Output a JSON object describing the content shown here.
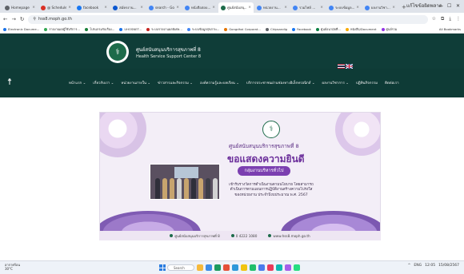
{
  "browser": {
    "tabs": [
      {
        "label": "Homepage",
        "color": "#5f6368",
        "active": false
      },
      {
        "label": "@ Schedule",
        "color": "#d93025",
        "active": false
      },
      {
        "label": "facebook",
        "color": "#1877f2",
        "active": false
      },
      {
        "label": "สมัครงาน...",
        "color": "#0b57d0",
        "active": false
      },
      {
        "label": "search - Goo...",
        "color": "#4285f4",
        "active": false
      },
      {
        "label": "หนังสือสอบ...",
        "color": "#4285f4",
        "active": false
      },
      {
        "label": "ศูนย์สนับสนุ...",
        "color": "#1d6b4a",
        "active": true
      },
      {
        "label": "หน่วยงาน...",
        "color": "#4285f4",
        "active": false
      },
      {
        "label": "รวมไฟล์ ...",
        "color": "#4285f4",
        "active": false
      },
      {
        "label": "ระบบข้อมูล...",
        "color": "#4285f4",
        "active": false
      },
      {
        "label": "ผลงานวิชา...",
        "color": "#4285f4",
        "active": false
      }
    ],
    "new_tab": "+",
    "account": "แก้ไขข้อผิดพลาด",
    "address": "hss8.moph.go.th",
    "bookmarks": [
      {
        "label": "Electronic Docume...",
        "color": "#1a73e8"
      },
      {
        "label": "รายงานผลผู้ใช้บริการ...",
        "color": "#34a853"
      },
      {
        "label": "โปรแกรมรับเรื่อง...",
        "color": "#188038"
      },
      {
        "label": "UHOSNET...",
        "color": "#1a73e8"
      },
      {
        "label": "ระบบรายงานผลพิเศษ...",
        "color": "#c5221f"
      },
      {
        "label": "ระบบข้อมูลสุขภาพ...",
        "color": "#4285f4"
      },
      {
        "label": "Gongdhai Corporat...",
        "color": "#e37400"
      },
      {
        "label": "Chipsandig",
        "color": "#5f6368"
      },
      {
        "label": "Facebook",
        "color": "#1877f2"
      },
      {
        "label": "ศูนย์อนามัยที่...",
        "color": "#0b8043"
      },
      {
        "label": "หนังสือ/Document",
        "color": "#f9ab00"
      },
      {
        "label": "ศูนย์รวม",
        "color": "#9334e6"
      }
    ],
    "all_bookmarks": "All Bookmarks"
  },
  "site": {
    "title_th": "ศูนย์สนับสนุนบริการสุขภาพที่ 8",
    "title_en": "Health Service Support Center 8",
    "nav": [
      "หน้าแรก",
      "เกี่ยวกับเรา",
      "หน่วยงานภายใน",
      "ข่าวสารและกิจกรรม",
      "องค์ความรู้และบทเรียน",
      "บริการประชาชนผ่านช่องทางอิเล็กทรอนิกส์",
      "ผลงานวิชาการ",
      "ปฏิทินกิจกรรม",
      "ติดต่อเรา"
    ],
    "dropdown_flags": [
      true,
      true,
      true,
      true,
      true,
      true,
      true,
      false,
      false
    ],
    "flags": [
      {
        "name": "thai-flag"
      },
      {
        "name": "uk-flag"
      }
    ]
  },
  "banner": {
    "heading": "ศูนย์สนับสนุนบริการสุขภาพที่ 8",
    "congrats": "ขอแสดงความยินดี",
    "group": "กลุ่มงานบริหารทั่วไป",
    "description": "เข้ารับรางวัลการดำเนินงานตามนโยบาย โดยสามารถดำเนินการตามแผนการปฏิบัติงานสร้างความโปร่งใสของหน่วยงาน ประจำปีงบประมาณ พ.ศ. 2567",
    "footer": [
      "ศูนย์สนับสนุนบริการสุขภาพที่ 8",
      "0 4222 1080",
      "www.hss8.moph.go.th"
    ]
  },
  "taskbar": {
    "weather": "อากาศร้อน",
    "weather_sub": "30°C",
    "search": "Search",
    "apps": [
      "#f6b93b",
      "#3c8ce7",
      "#1b9b5f",
      "#e55039",
      "#2d98da",
      "#f1c40f",
      "#20bf6b",
      "#4b7bec",
      "#eb3b5a",
      "#0fb9b1",
      "#a55eea",
      "#26de81"
    ],
    "tray": [
      "^",
      "ENG",
      "12:05",
      "15/08/2567"
    ]
  }
}
